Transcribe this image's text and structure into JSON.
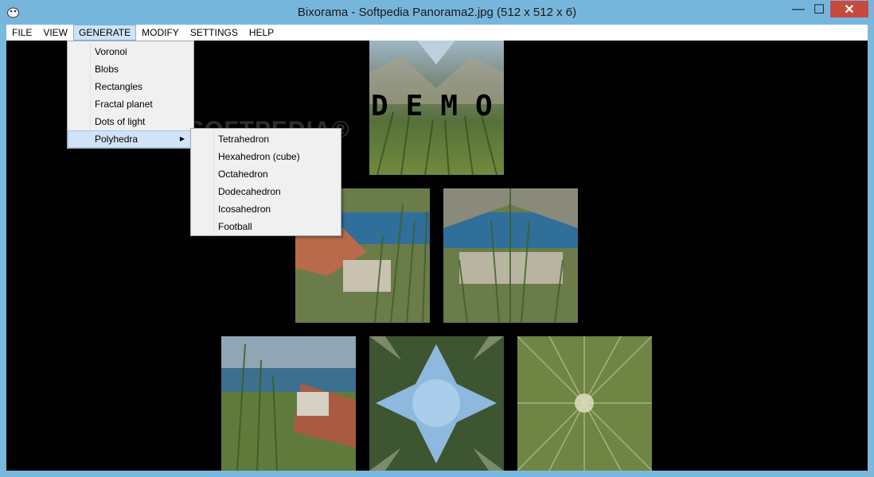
{
  "window": {
    "title": "Bixorama - Softpedia Panorama2.jpg (512 x 512 x 6)",
    "controls": {
      "minimize": "—",
      "maximize": "☐",
      "close": "✕"
    }
  },
  "menubar": {
    "items": [
      {
        "label": "FILE"
      },
      {
        "label": "VIEW"
      },
      {
        "label": "GENERATE"
      },
      {
        "label": "MODIFY"
      },
      {
        "label": "SETTINGS"
      },
      {
        "label": "HELP"
      }
    ],
    "active": "GENERATE"
  },
  "generate_menu": {
    "items": [
      {
        "label": "Voronoi"
      },
      {
        "label": "Blobs"
      },
      {
        "label": "Rectangles"
      },
      {
        "label": "Fractal planet"
      },
      {
        "label": "Dots of light"
      },
      {
        "label": "Polyhedra",
        "has_submenu": true
      }
    ],
    "highlighted": "Polyhedra"
  },
  "polyhedra_submenu": {
    "items": [
      {
        "label": "Tetrahedron"
      },
      {
        "label": "Hexahedron (cube)"
      },
      {
        "label": "Octahedron"
      },
      {
        "label": "Dodecahedron"
      },
      {
        "label": "Icosahedron"
      },
      {
        "label": "Football"
      }
    ]
  },
  "canvas": {
    "demo_text": "DEMO",
    "watermark": "SOFTPEDIA®",
    "faces": [
      {
        "name": "top",
        "style": "town-sky"
      },
      {
        "name": "left",
        "style": "town-water"
      },
      {
        "name": "front",
        "style": "town-water-mirror"
      },
      {
        "name": "right",
        "style": "town-cliff"
      },
      {
        "name": "sky",
        "style": "sky-star"
      },
      {
        "name": "ground",
        "style": "grass-burst"
      }
    ]
  },
  "colors": {
    "titlebar": "#77b6dc",
    "menu_active": "#cde4f7",
    "menu_hover": "#d1e3f7",
    "close_button": "#c74a3f"
  }
}
